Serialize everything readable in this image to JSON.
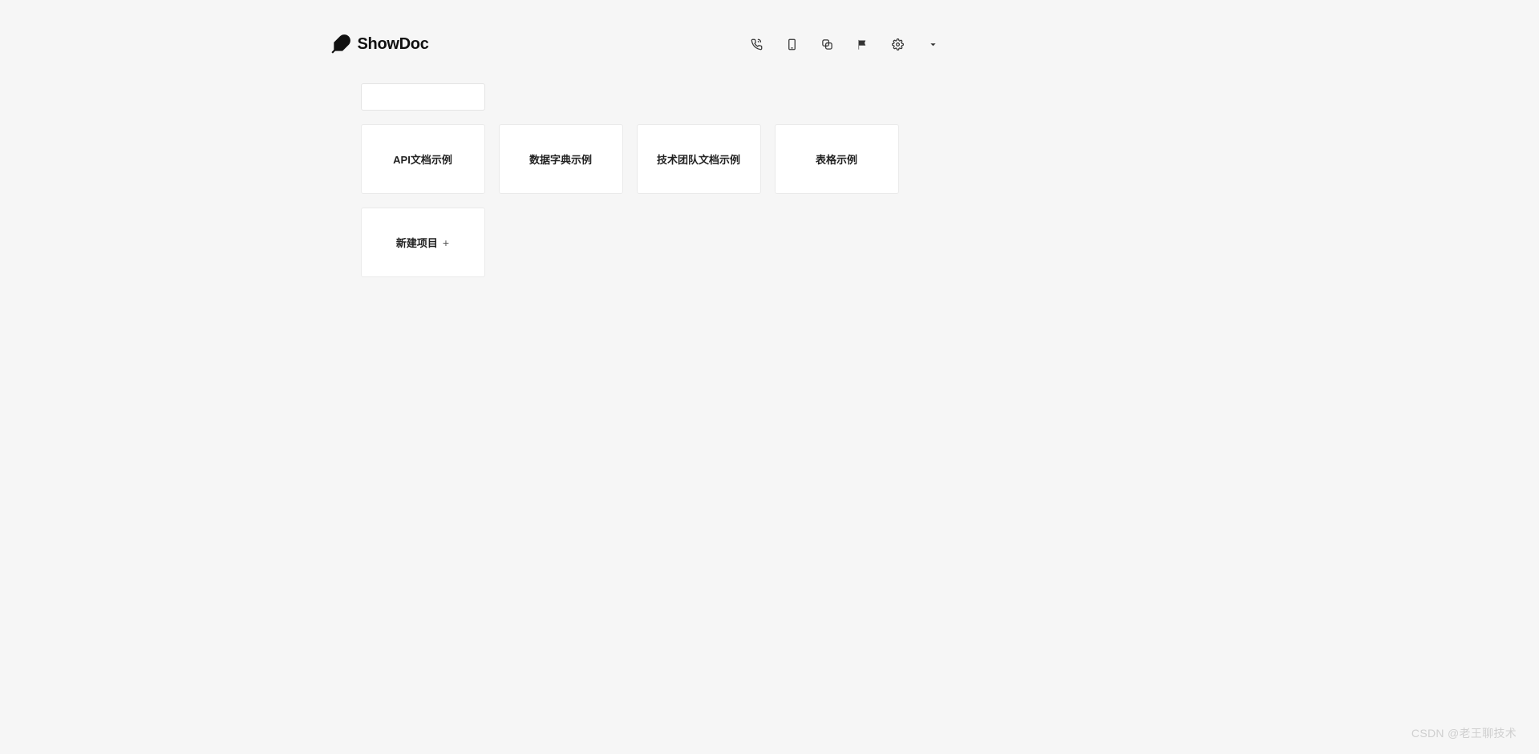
{
  "app": {
    "name": "ShowDoc"
  },
  "search": {
    "placeholder": ""
  },
  "cards": [
    {
      "label": "API文档示例"
    },
    {
      "label": "数据字典示例"
    },
    {
      "label": "技术团队文档示例"
    },
    {
      "label": "表格示例"
    }
  ],
  "newProject": {
    "label": "新建项目",
    "plus": "+"
  },
  "watermark": "CSDN @老王聊技术"
}
